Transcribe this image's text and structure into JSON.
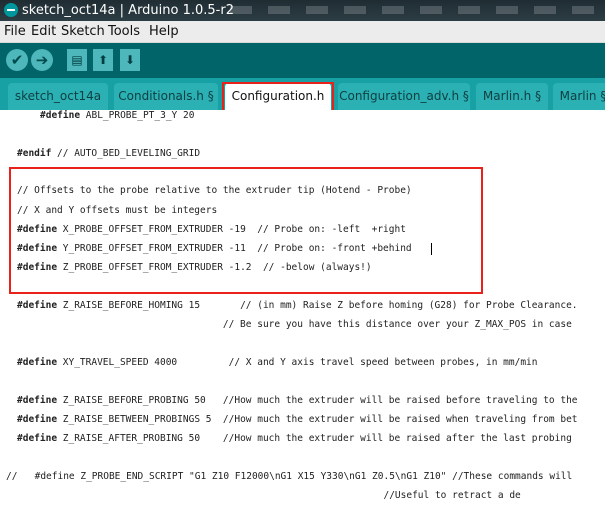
{
  "window": {
    "title": "sketch_oct14a | Arduino 1.0.5-r2"
  },
  "menu": {
    "items": [
      "File",
      "Edit",
      "Sketch",
      "Tools",
      "Help"
    ]
  },
  "toolbar": {
    "buttons": [
      {
        "name": "verify",
        "glyph": "✔"
      },
      {
        "name": "upload",
        "glyph": "➔"
      },
      {
        "name": "new",
        "glyph": "▤"
      },
      {
        "name": "open",
        "glyph": "⬆"
      },
      {
        "name": "save",
        "glyph": "⬇"
      }
    ]
  },
  "tabs": [
    "sketch_oct14a",
    "Conditionals.h §",
    "Configuration.h",
    "Configuration_adv.h §",
    "Marlin.h §",
    "Marlin §"
  ],
  "active_tab": "Configuration.h",
  "code": [
    {
      "kw": "#define",
      "rest": " ABL_PROBE_PT_3_Y 20"
    },
    {
      "kw": "",
      "rest": ""
    },
    {
      "kw": "#endif",
      "rest": " // AUTO_BED_LEVELING_GRID"
    },
    {
      "kw": "",
      "rest": ""
    },
    {
      "kw": "",
      "rest": "// Offsets to the probe relative to the extruder tip (Hotend - Probe)"
    },
    {
      "kw": "",
      "rest": "// X and Y offsets must be integers"
    },
    {
      "kw": "#define",
      "rest": " X_PROBE_OFFSET_FROM_EXTRUDER -19  // Probe on: -left  +right"
    },
    {
      "kw": "#define",
      "rest": " Y_PROBE_OFFSET_FROM_EXTRUDER -11  // Probe on: -front +behind"
    },
    {
      "kw": "#define",
      "rest": " Z_PROBE_OFFSET_FROM_EXTRUDER -1.2  // -below (always!)"
    },
    {
      "kw": "",
      "rest": ""
    },
    {
      "kw": "#define",
      "rest": " Z_RAISE_BEFORE_HOMING 15       // (in mm) Raise Z before homing (G28) for Probe Clearance."
    },
    {
      "kw": "",
      "rest": "                                    // Be sure you have this distance over your Z_MAX_POS in case"
    },
    {
      "kw": "",
      "rest": ""
    },
    {
      "kw": "#define",
      "rest": " XY_TRAVEL_SPEED 4000         // X and Y axis travel speed between probes, in mm/min"
    },
    {
      "kw": "",
      "rest": ""
    },
    {
      "kw": "#define",
      "rest": " Z_RAISE_BEFORE_PROBING 50   //How much the extruder will be raised before traveling to the"
    },
    {
      "kw": "#define",
      "rest": " Z_RAISE_BETWEEN_PROBINGS 5  //How much the extruder will be raised when traveling from bet"
    },
    {
      "kw": "#define",
      "rest": " Z_RAISE_AFTER_PROBING 50    //How much the extruder will be raised after the last probing"
    },
    {
      "kw": "",
      "rest": ""
    },
    {
      "kw": "",
      "rest": "//   #define Z_PROBE_END_SCRIPT \"G1 Z10 F12000\\nG1 X15 Y330\\nG1 Z0.5\\nG1 Z10\" //These commands will"
    },
    {
      "kw": "",
      "rest": "                                                                  //Useful to retract a de"
    }
  ]
}
